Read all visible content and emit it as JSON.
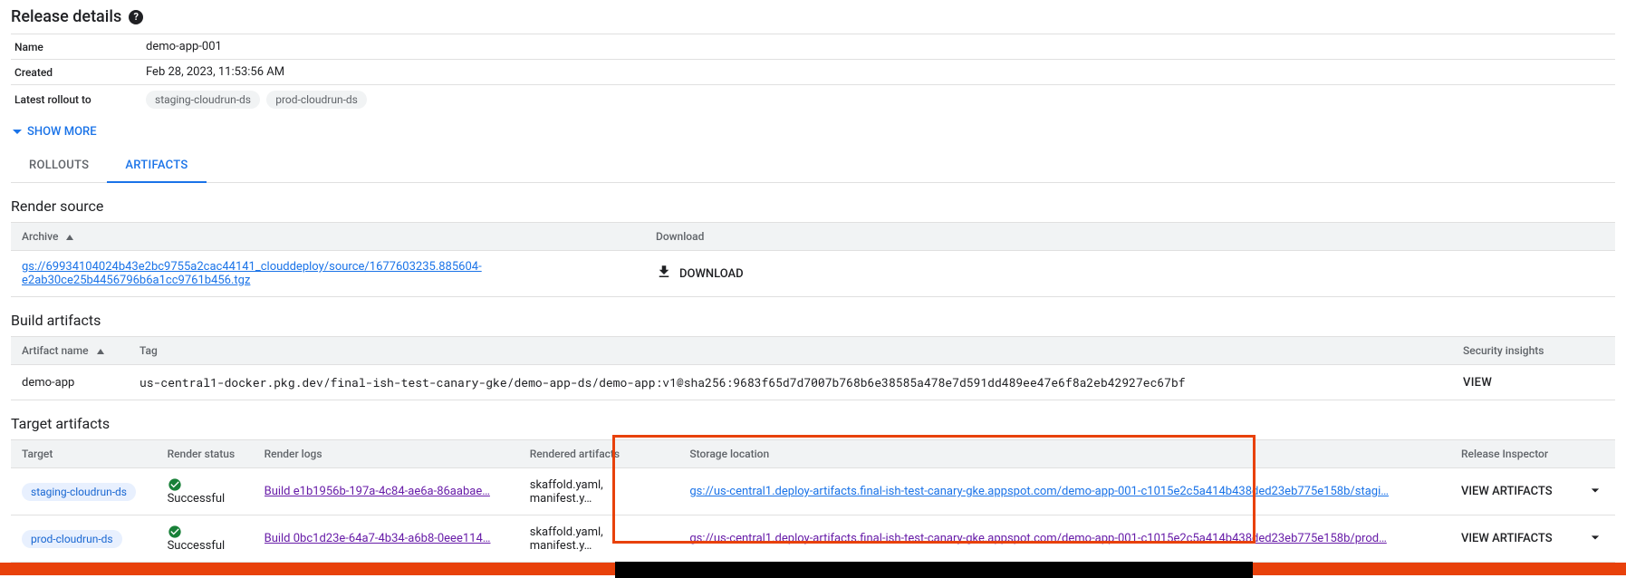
{
  "header": {
    "title": "Release details"
  },
  "meta": {
    "name_key": "Name",
    "name_value": "demo-app-001",
    "created_key": "Created",
    "created_value": "Feb 28, 2023, 11:53:56 AM",
    "latest_key": "Latest rollout to",
    "chips": [
      "staging-cloudrun-ds",
      "prod-cloudrun-ds"
    ]
  },
  "show_more": "SHOW MORE",
  "tabs": {
    "rollouts": "ROLLOUTS",
    "artifacts": "ARTIFACTS"
  },
  "render_source": {
    "title": "Render source",
    "cols": {
      "archive": "Archive",
      "download": "Download"
    },
    "row": {
      "archive_link": "gs://69934104024b43e2bc9755a2cac44141_clouddeploy/source/1677603235.885604-e2ab30ce25b4456796b6a1cc9761b456.tgz",
      "download_label": "DOWNLOAD"
    }
  },
  "build_artifacts": {
    "title": "Build artifacts",
    "cols": {
      "name": "Artifact name",
      "tag": "Tag",
      "insights": "Security insights"
    },
    "row": {
      "name": "demo-app",
      "tag": "us-central1-docker.pkg.dev/final-ish-test-canary-gke/demo-app-ds/demo-app:v1@sha256:9683f65d7d7007b768b6e38585a478e7d591dd489ee47e6f8a2eb42927ec67bf",
      "view": "VIEW"
    }
  },
  "target_artifacts": {
    "title": "Target artifacts",
    "cols": {
      "target": "Target",
      "render_status": "Render status",
      "render_logs": "Render logs",
      "rendered_artifacts": "Rendered artifacts",
      "storage": "Storage location",
      "inspector": "Release Inspector"
    },
    "rows": [
      {
        "target": "staging-cloudrun-ds",
        "status": "Successful",
        "logs": "Build e1b1956b-197a-4c84-ae6a-86aabae…",
        "artifacts": "skaffold.yaml, manifest.y…",
        "storage": "gs://us-central1.deploy-artifacts.final-ish-test-canary-gke.appspot.com/demo-app-001-c1015e2c5a414b438ded23eb775e158b/stagi…",
        "view": "VIEW ARTIFACTS"
      },
      {
        "target": "prod-cloudrun-ds",
        "status": "Successful",
        "logs": "Build 0bc1d23e-64a7-4b34-a6b8-0eee114…",
        "artifacts": "skaffold.yaml, manifest.y…",
        "storage": "gs://us-central1.deploy-artifacts.final-ish-test-canary-gke.appspot.com/demo-app-001-c1015e2c5a414b438ded23eb775e158b/prod…",
        "view": "VIEW ARTIFACTS"
      }
    ]
  }
}
